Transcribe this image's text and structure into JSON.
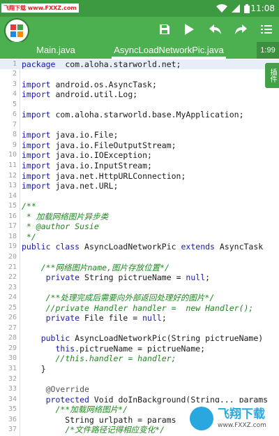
{
  "status_bar": {
    "watermark_left": "飞翔下载",
    "watermark_url": "www.FXXZ.com",
    "time": "11:08",
    "icons": [
      "wifi-icon",
      "signal-icon",
      "battery-icon"
    ]
  },
  "toolbar": {
    "logo": "app-logo-icon",
    "actions": [
      "save-icon",
      "run-icon",
      "undo-icon",
      "redo-icon",
      "menu-icon"
    ]
  },
  "tabs": [
    {
      "label": "Main.java"
    },
    {
      "label": "AsyncLoadNetworkPic.java"
    }
  ],
  "tab_count": "1:99",
  "plugin_tab": "插件",
  "editor": {
    "lines": [
      {
        "n": "1",
        "parts": [
          [
            "kw",
            "package"
          ],
          [
            "",
            "  com.aloha.starworld.net;"
          ]
        ]
      },
      {
        "n": "2",
        "parts": []
      },
      {
        "n": "3",
        "parts": [
          [
            "kw",
            "import"
          ],
          [
            "",
            " android.os.AsyncTask;"
          ]
        ]
      },
      {
        "n": "4",
        "parts": [
          [
            "kw",
            "import"
          ],
          [
            "",
            " android.util.Log;"
          ]
        ]
      },
      {
        "n": "5",
        "parts": []
      },
      {
        "n": "6",
        "parts": [
          [
            "kw",
            "import"
          ],
          [
            "",
            " com.aloha.starworld.base.MyApplication;"
          ]
        ]
      },
      {
        "n": "7",
        "parts": []
      },
      {
        "n": "8",
        "parts": [
          [
            "kw",
            "import"
          ],
          [
            "",
            " java.io.File;"
          ]
        ]
      },
      {
        "n": "9",
        "parts": [
          [
            "kw",
            "import"
          ],
          [
            "",
            " java.io.FileOutputStream;"
          ]
        ]
      },
      {
        "n": "10",
        "parts": [
          [
            "kw",
            "import"
          ],
          [
            "",
            " java.io.IOException;"
          ]
        ]
      },
      {
        "n": "11",
        "parts": [
          [
            "kw",
            "import"
          ],
          [
            "",
            " java.io.InputStream;"
          ]
        ]
      },
      {
        "n": "12",
        "parts": [
          [
            "kw",
            "import"
          ],
          [
            "",
            " java.net.HttpURLConnection;"
          ]
        ]
      },
      {
        "n": "13",
        "parts": [
          [
            "kw",
            "import"
          ],
          [
            "",
            " java.net.URL;"
          ]
        ]
      },
      {
        "n": "14",
        "parts": []
      },
      {
        "n": "15",
        "parts": [
          [
            "cm",
            "/**"
          ]
        ]
      },
      {
        "n": "16",
        "parts": [
          [
            "cm",
            " * 加载网络图片异步类"
          ]
        ]
      },
      {
        "n": "17",
        "parts": [
          [
            "cm",
            " * @author Susie"
          ]
        ]
      },
      {
        "n": "18",
        "parts": [
          [
            "cm",
            " */"
          ]
        ]
      },
      {
        "n": "19",
        "parts": [
          [
            "kw",
            "public class"
          ],
          [
            "",
            " AsyncLoadNetworkPic "
          ],
          [
            "kw",
            "extends"
          ],
          [
            "",
            " AsyncTask"
          ]
        ]
      },
      {
        "n": "20",
        "parts": []
      },
      {
        "n": "21",
        "parts": [
          [
            "",
            "    "
          ],
          [
            "cm",
            "/**网络图片name,图片存放位置*/"
          ]
        ]
      },
      {
        "n": "22",
        "parts": [
          [
            "",
            "     "
          ],
          [
            "kw",
            "private"
          ],
          [
            "",
            " String pictrueName = "
          ],
          [
            "kw",
            "null"
          ],
          [
            "",
            ";"
          ]
        ]
      },
      {
        "n": "23",
        "parts": []
      },
      {
        "n": "24",
        "parts": [
          [
            "",
            "     "
          ],
          [
            "cm",
            "/**处理完成后需要向外部返回处理好的图片*/"
          ]
        ]
      },
      {
        "n": "25",
        "parts": [
          [
            "",
            "     "
          ],
          [
            "cm",
            "//private Handler handler =  new Handler();"
          ]
        ]
      },
      {
        "n": "26",
        "parts": [
          [
            "",
            "     "
          ],
          [
            "kw",
            "private"
          ],
          [
            "",
            " File file = "
          ],
          [
            "kw",
            "null"
          ],
          [
            "",
            ";"
          ]
        ]
      },
      {
        "n": "27",
        "parts": []
      },
      {
        "n": "28",
        "parts": [
          [
            "",
            "    "
          ],
          [
            "kw",
            "public"
          ],
          [
            "",
            " AsyncLoadNetworkPic(String pictrueName)"
          ]
        ]
      },
      {
        "n": "29",
        "parts": [
          [
            "",
            "       "
          ],
          [
            "kw",
            "this"
          ],
          [
            "",
            ".pictrueName = pictrueName;"
          ]
        ]
      },
      {
        "n": "30",
        "parts": [
          [
            "",
            "       "
          ],
          [
            "cm",
            "//this.handler = handler;"
          ]
        ]
      },
      {
        "n": "31",
        "parts": [
          [
            "",
            "    }"
          ]
        ]
      },
      {
        "n": "32",
        "parts": []
      },
      {
        "n": "33",
        "parts": [
          [
            "",
            "     "
          ],
          [
            "an",
            "@Override"
          ]
        ]
      },
      {
        "n": "34",
        "parts": [
          [
            "",
            "     "
          ],
          [
            "kw",
            "protected"
          ],
          [
            "",
            " Void doInBackground(String... params"
          ]
        ]
      },
      {
        "n": "35",
        "parts": [
          [
            "",
            "       "
          ],
          [
            "cm",
            "/**加载网络图片*/"
          ]
        ]
      },
      {
        "n": "36",
        "parts": [
          [
            "",
            "         String urlpath = params"
          ]
        ]
      },
      {
        "n": "37",
        "parts": [
          [
            "",
            "         "
          ],
          [
            "cm",
            "/*文件路径记得相应变化*/"
          ]
        ]
      }
    ]
  },
  "watermark_right": {
    "title": "飞翔下载",
    "url": "www.FXXZ.com"
  }
}
